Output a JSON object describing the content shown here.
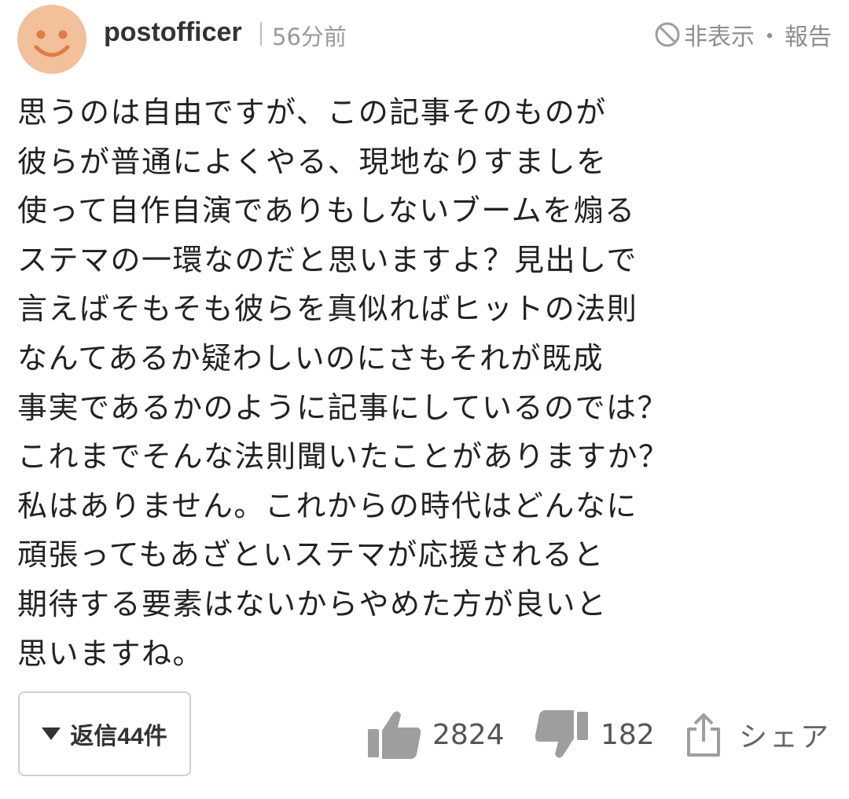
{
  "comment": {
    "username": "postofficer",
    "timestamp": "56分前",
    "hide_label": "非表示",
    "separator": "・",
    "report_label": "報告",
    "body_lines": [
      "思うのは自由ですが、この記事そのものが",
      "彼らが普通によくやる、現地なりすましを",
      "使って自作自演でありもしないブームを煽る",
      "ステマの一環なのだと思いますよ？見出しで",
      "言えばそもそも彼らを真似ればヒットの法則",
      "なんてあるか疑わしいのにさもそれが既成",
      "事実であるかのように記事にしているのでは？",
      "これまでそんな法則聞いたことがありますか？",
      "私はありません。これからの時代はどんなに",
      "頑張ってもあざといステマが応援されると",
      "期待する要素はないからやめた方が良いと",
      "思いますね。"
    ],
    "replies_label": "返信44件",
    "like_count": "2824",
    "dislike_count": "182",
    "share_label": "シェア"
  },
  "icons": {
    "avatar": "smiley-face",
    "hide": "ban-icon",
    "replies": "triangle-down-icon",
    "like": "thumbs-up-icon",
    "dislike": "thumbs-down-icon",
    "share": "share-icon"
  },
  "colors": {
    "avatar_bg": "#f2c09b",
    "avatar_features": "#e07b46",
    "icon_gray": "#9e9e9e",
    "text": "#222222",
    "muted": "#9a9a9a"
  }
}
